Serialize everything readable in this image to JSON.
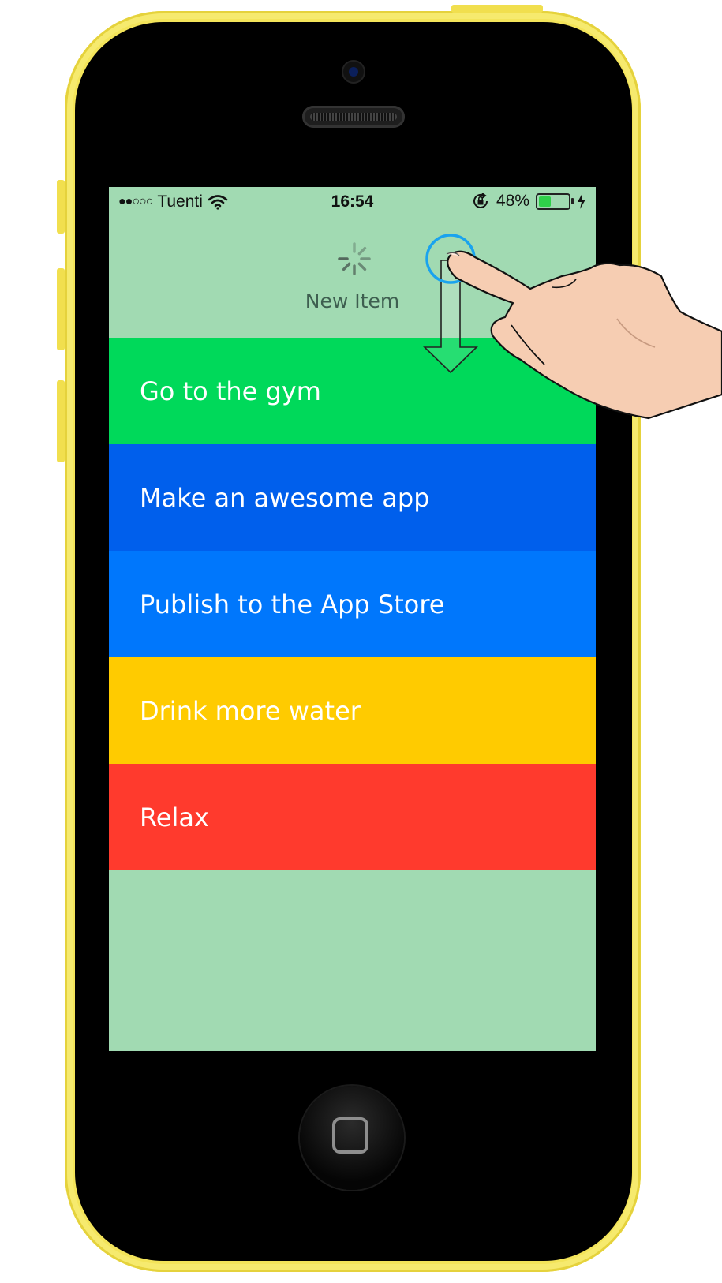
{
  "status_bar": {
    "signal": "●●○○○",
    "carrier": "Tuenti",
    "time": "16:54",
    "battery_percent": "48%",
    "battery_level": 0.48,
    "icons": [
      "wifi-icon",
      "rotation-lock-icon",
      "battery-icon",
      "charging-bolt-icon"
    ]
  },
  "pull_to_add": {
    "label": "New Item",
    "icon": "loading-spinner-icon"
  },
  "items": [
    {
      "label": "Go to the gym",
      "color": "#00d95a"
    },
    {
      "label": "Make an awesome app",
      "color": "#005fec"
    },
    {
      "label": "Publish to the App Store",
      "color": "#0077fc"
    },
    {
      "label": "Drink more water",
      "color": "#ffcb00"
    },
    {
      "label": "Relax",
      "color": "#ff3a2d"
    }
  ],
  "screen_background": "#a1dab2",
  "phone_color": "#f3e45a",
  "gesture": {
    "type": "pull-down",
    "touch_color": "#1aa3ee",
    "icons": [
      "touch-point-icon",
      "down-arrow-icon",
      "hand-pointer-icon"
    ]
  }
}
